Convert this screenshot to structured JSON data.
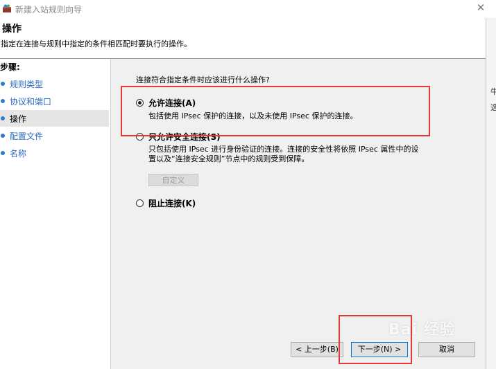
{
  "window": {
    "title": "新建入站规则向导",
    "icon": "firewall-wizard-icon",
    "close_icon": "✕"
  },
  "header": {
    "title": "操作",
    "description": "指定在连接与规则中指定的条件相匹配时要执行的操作。"
  },
  "sidebar": {
    "steps_label": "步骤:",
    "items": [
      {
        "label": "规则类型"
      },
      {
        "label": "协议和端口"
      },
      {
        "label": "操作",
        "active": true
      },
      {
        "label": "配置文件"
      },
      {
        "label": "名称"
      }
    ]
  },
  "main": {
    "question": "连接符合指定条件时应该进行什么操作?",
    "options": [
      {
        "label": "允许连接(A)",
        "description": "包括使用 IPsec 保护的连接，以及未使用 IPsec 保护的连接。",
        "selected": true
      },
      {
        "label": "只允许安全连接(S)",
        "description_line1": "只包括使用 IPsec 进行身份验证的连接。连接的安全性将依照 IPsec 属性中的设",
        "description_line2": "置以及“连接安全规则”节点中的规则受到保障。",
        "selected": false
      },
      {
        "label": "阻止连接(K)",
        "selected": false
      }
    ],
    "custom_button": "自定义"
  },
  "footer": {
    "back_label": "< 上一步(B)",
    "next_label": "下一步(N) >",
    "cancel_label": "取消"
  },
  "right_edge": {
    "text1": "牛",
    "text2": "选"
  },
  "watermark": "Bai 经验",
  "colors": {
    "highlight": "#e5383b",
    "link": "#2a6bc0",
    "content_bg": "#f0f0f0"
  }
}
